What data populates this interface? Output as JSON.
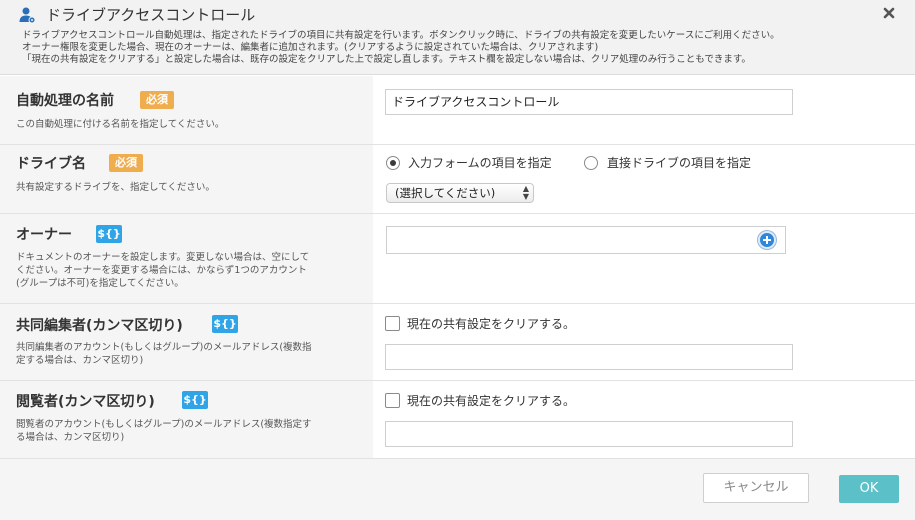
{
  "dialog": {
    "title": "ドライブアクセスコントロール",
    "icon": "user-settings-icon",
    "description": [
      "ドライブアクセスコントロール自動処理は、指定されたドライブの項目に共有設定を行います。ボタンクリック時に、ドライブの共有設定を変更したいケースにご利用ください。",
      "オーナー権限を変更した場合、現在のオーナーは、編集者に追加されます。(クリアするように設定されていた場合は、クリアされます)",
      "「現在の共有設定をクリアする」と設定した場合は、既存の設定をクリアした上で設定し直します。テキスト欄を設定しない場合は、クリア処理のみ行うこともできます。"
    ]
  },
  "fields": {
    "name": {
      "label": "自動処理の名前",
      "badge": "必須",
      "help": "この自動処理に付ける名前を指定してください。",
      "value": "ドライブアクセスコントロール"
    },
    "drive": {
      "label": "ドライブ名",
      "badge": "必須",
      "help": "共有設定するドライブを、指定してください。",
      "option_form": "入力フォームの項目を指定",
      "option_direct": "直接ドライブの項目を指定",
      "selected_option": "入力フォームの項目を指定",
      "select_value": "(選択してください)"
    },
    "owner": {
      "label": "オーナー",
      "badge": "${}",
      "help": [
        "ドキュメントのオーナーを設定します。変更しない場合は、空にして",
        "ください。オーナーを変更する場合には、かならず1つのアカウント",
        "(グループは不可)を指定してください。"
      ],
      "value": ""
    },
    "editors": {
      "label": "共同編集者(カンマ区切り)",
      "badge": "${}",
      "help": [
        "共同編集者のアカウント(もしくはグループ)のメールアドレス(複数指",
        "定する場合は、カンマ区切り)"
      ],
      "clear_label": "現在の共有設定をクリアする。",
      "clear_checked": false,
      "value": ""
    },
    "viewers": {
      "label": "閲覧者(カンマ区切り)",
      "badge": "${}",
      "help": [
        "閲覧者のアカウント(もしくはグループ)のメールアドレス(複数指定す",
        "る場合は、カンマ区切り)"
      ],
      "clear_label": "現在の共有設定をクリアする。",
      "clear_checked": false,
      "value": ""
    }
  },
  "buttons": {
    "cancel": "キャンセル",
    "ok": "OK"
  },
  "colors": {
    "required_badge": "#f0ad4e",
    "variable_badge": "#2fa4e7",
    "ok_button": "#5bc0c8",
    "add_button": "#2e86de"
  }
}
